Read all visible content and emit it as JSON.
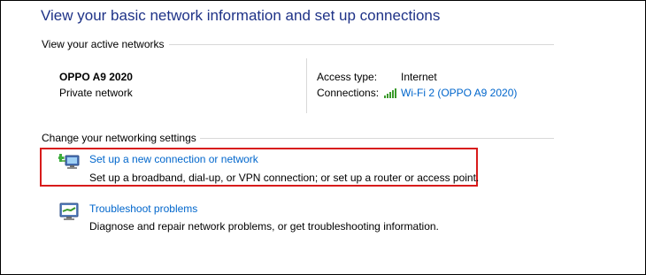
{
  "page_title": "View your basic network information and set up connections",
  "active_networks": {
    "header": "View your active networks",
    "network_name": "OPPO A9 2020",
    "network_type": "Private network",
    "access_type_label": "Access type:",
    "access_type_value": "Internet",
    "connections_label": "Connections:",
    "connections_value": "Wi-Fi 2 (OPPO A9 2020)",
    "connection_icon": "wifi-signal-icon"
  },
  "networking_settings": {
    "header": "Change your networking settings",
    "tasks": [
      {
        "icon": "new-connection-icon",
        "link": "Set up a new connection or network",
        "description": "Set up a broadband, dial-up, or VPN connection; or set up a router or access point."
      },
      {
        "icon": "troubleshoot-icon",
        "link": "Troubleshoot problems",
        "description": "Diagnose and repair network problems, or get troubleshooting information."
      }
    ]
  },
  "colors": {
    "title": "#1e3287",
    "link": "#0066cc",
    "highlight": "#d81b1b",
    "signal": "#3a9a2a"
  }
}
